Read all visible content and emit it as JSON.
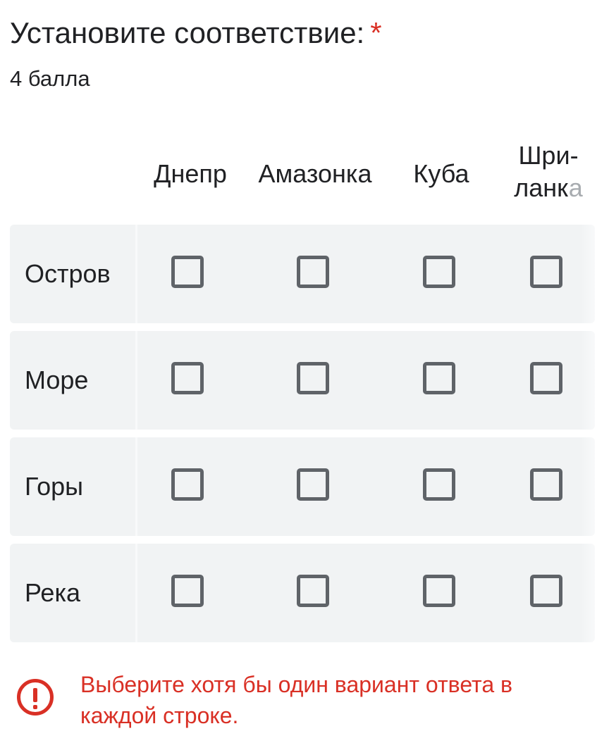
{
  "question": {
    "title": "Установите соответствие:",
    "required_mark": "*",
    "points": "4 балла"
  },
  "columns": [
    {
      "label": "Днепр"
    },
    {
      "label": "Амазонка"
    },
    {
      "label": "Куба"
    },
    {
      "label_part1": "Шри-",
      "label_part2": "ланк",
      "label_part3": "а"
    }
  ],
  "rows": [
    {
      "label": "Остров",
      "checked": [
        false,
        false,
        false,
        false
      ]
    },
    {
      "label": "Море",
      "checked": [
        false,
        false,
        false,
        false
      ]
    },
    {
      "label": "Горы",
      "checked": [
        false,
        false,
        false,
        false
      ]
    },
    {
      "label": "Река",
      "checked": [
        false,
        false,
        false,
        false
      ]
    }
  ],
  "error": {
    "icon": "error-icon",
    "message": "Выберите хотя бы один вариант ответа в каждой строке."
  },
  "colors": {
    "error": "#d93025",
    "row_background": "#f1f3f4",
    "checkbox_border": "#5f6368"
  }
}
